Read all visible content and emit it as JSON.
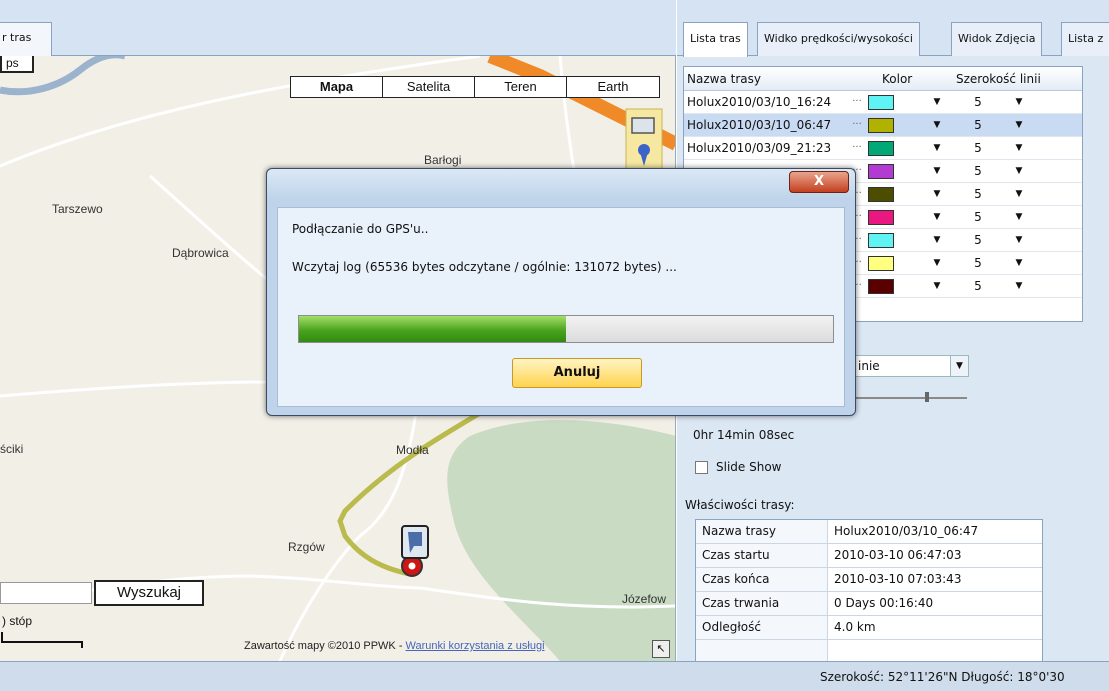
{
  "left_tab": {
    "label": "r tras"
  },
  "map": {
    "types": [
      "Mapa",
      "Satelita",
      "Teren",
      "Earth"
    ],
    "active_type": "Mapa",
    "ps_button": "ps",
    "places": {
      "barlogi": "Barłogi",
      "tarszewo": "Tarszewo",
      "dabrowica": "Dąbrowica",
      "modla": "Modła",
      "rzgow": "Rzgów",
      "jozefow": "Józefow",
      "sciki": "ściki"
    },
    "search_button": "Wyszukaj",
    "scale_label": ") stóp",
    "copyright_text": "Zawartość mapy ©2010 PPWK - ",
    "copyright_link": "Warunki korzystania z usługi",
    "corner_glyph": "↖"
  },
  "right_tabs": [
    "Lista tras",
    "Widko prędkości/wysokości",
    "Widok Zdjęcia",
    "Lista z"
  ],
  "track_grid": {
    "headers": {
      "name": "Nazwa trasy",
      "color": "Kolor",
      "width": "Szerokość linii"
    },
    "rows": [
      {
        "name": "Holux2010/03/10_16:24",
        "color": "#5ff3f3",
        "width": "5"
      },
      {
        "name": "Holux2010/03/10_06:47",
        "color": "#b1b100",
        "width": "5"
      },
      {
        "name": "Holux2010/03/09_21:23",
        "color": "#00a877",
        "width": "5"
      },
      {
        "name": "",
        "color": "#b23cd2",
        "width": "5"
      },
      {
        "name": "",
        "color": "#4d4d00",
        "width": "5"
      },
      {
        "name": "",
        "color": "#ea1780",
        "width": "5"
      },
      {
        "name": "",
        "color": "#5ff3f3",
        "width": "5"
      },
      {
        "name": "",
        "color": "#ffff80",
        "width": "5"
      },
      {
        "name": "",
        "color": "#5a0000",
        "width": "5"
      }
    ],
    "dots": "···",
    "arrow": "▼"
  },
  "combo_value": "inie",
  "duration": "0hr 14min 08sec",
  "slideshow_label": "Slide Show",
  "props": {
    "title": "Właściwości trasy:",
    "rows": [
      {
        "key": "Nazwa trasy",
        "value": "Holux2010/03/10_06:47"
      },
      {
        "key": "Czas startu",
        "value": "2010-03-10 06:47:03"
      },
      {
        "key": "Czas końca",
        "value": "2010-03-10 07:03:43"
      },
      {
        "key": "Czas trwania",
        "value": "0 Days  00:16:40"
      },
      {
        "key": "Odległość",
        "value": "4.0 km"
      }
    ]
  },
  "status": {
    "text": "Szerokość: 52°11'26\"N  Długość: 18°0'30"
  },
  "dialog": {
    "close_label": "X",
    "connecting": "Podłączanie do GPS'u..",
    "loading": "Wczytaj log  (65536 bytes odczytane / ogólnie: 131072 bytes) ...",
    "progress": 0.5,
    "cancel_label": "Anuluj"
  },
  "colors": {
    "route": "#b4b43c",
    "road_orange": "#f08a28",
    "forest": "#c8dcc0",
    "river": "#9bb3cc"
  }
}
